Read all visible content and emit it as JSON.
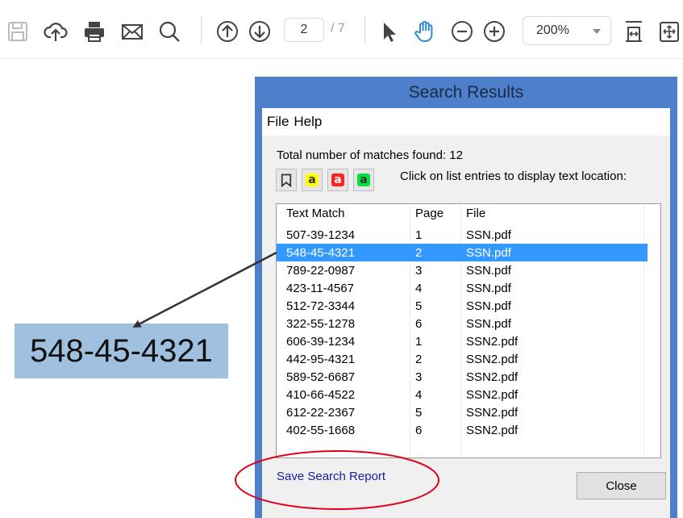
{
  "toolbar": {
    "icons": [
      "save-icon",
      "cloud-upload-icon",
      "print-icon",
      "mail-icon",
      "search-icon",
      "page-up-icon",
      "page-down-icon",
      "pointer-icon",
      "hand-icon",
      "zoom-out-icon",
      "zoom-in-icon",
      "fit-page-icon",
      "fit-width-icon"
    ],
    "page_current": "2",
    "page_total": "/ 7",
    "zoom": "200%"
  },
  "dialog": {
    "title": "Search Results",
    "menu": [
      "File",
      "Help"
    ],
    "summary": "Total number of matches found: 12",
    "hint": "Click on list entries to display text location:",
    "highlight_buttons": [
      {
        "glyph": "a",
        "fill": "#ffff00",
        "text_color": "#333333"
      },
      {
        "glyph": "a",
        "fill": "#ff2020",
        "text_color": "#ffffff"
      },
      {
        "glyph": "a",
        "fill": "#00e040",
        "text_color": "#333333"
      }
    ],
    "columns": [
      "Text Match",
      "Page",
      "File"
    ],
    "rows": [
      {
        "match": "507-39-1234",
        "page": "1",
        "file": "SSN.pdf"
      },
      {
        "match": "548-45-4321",
        "page": "2",
        "file": "SSN.pdf"
      },
      {
        "match": "789-22-0987",
        "page": "3",
        "file": "SSN.pdf"
      },
      {
        "match": "423-11-4567",
        "page": "4",
        "file": "SSN.pdf"
      },
      {
        "match": "512-72-3344",
        "page": "5",
        "file": "SSN.pdf"
      },
      {
        "match": "322-55-1278",
        "page": "6",
        "file": "SSN.pdf"
      },
      {
        "match": "606-39-1234",
        "page": "1",
        "file": "SSN2.pdf"
      },
      {
        "match": "442-95-4321",
        "page": "2",
        "file": "SSN2.pdf"
      },
      {
        "match": "589-52-6687",
        "page": "3",
        "file": "SSN2.pdf"
      },
      {
        "match": "410-66-4522",
        "page": "4",
        "file": "SSN2.pdf"
      },
      {
        "match": "612-22-2367",
        "page": "5",
        "file": "SSN2.pdf"
      },
      {
        "match": "402-55-1668",
        "page": "6",
        "file": "SSN2.pdf"
      }
    ],
    "selected_row": 1,
    "save_report": "Save Search Report",
    "close": "Close"
  },
  "document_highlight": "548-45-4321",
  "colors": {
    "dialog_frame": "#4e7fcb",
    "selection": "#3399ff",
    "doc_highlight": "#9fc1df",
    "annotation_red": "#e0001b",
    "arrow": "#333333"
  }
}
